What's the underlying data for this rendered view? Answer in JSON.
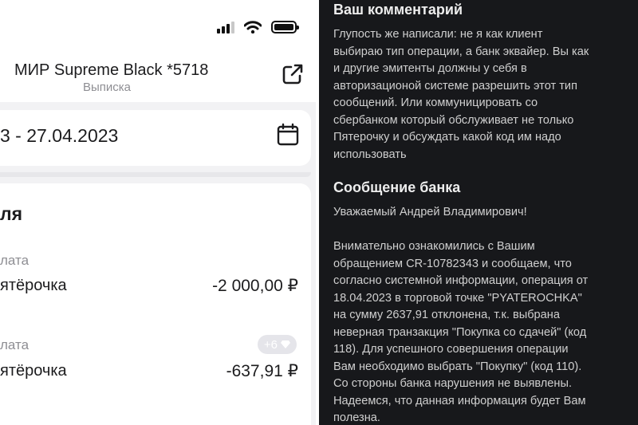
{
  "phone": {
    "card_title": "МИР Supreme Black *5718",
    "card_subtitle": "Выписка",
    "date_range": "3 - 27.04.2023",
    "day_label": "ля",
    "transactions": [
      {
        "type": "лата",
        "merchant": "ятёрочка",
        "amount": "-2 000,00 ₽"
      },
      {
        "type": "лата",
        "merchant": "ятёрочка",
        "amount": "-637,91 ₽",
        "badge": "+6"
      }
    ]
  },
  "comment": {
    "heading": "Ваш комментарий",
    "lines": [
      "Глупость же написали: не я как клиент",
      "выбираю тип операции, а банк эквайер. Вы как",
      "и другие эмитенты должны у себя в",
      "авторизационой системе разрешить этот тип",
      "сообщений. Или коммуницировать со",
      "сбербанком который обслуживает не только",
      "Пятерочку и обсуждать какой код им надо",
      "использовать"
    ]
  },
  "bank": {
    "heading": "Сообщение банка",
    "greeting": "Уважаемый Андрей Владимирович!",
    "lines": [
      "Внимательно ознакомились с Вашим",
      "обращением CR-10782343 и сообщаем, что",
      "согласно системной информации, операция от",
      "18.04.2023 в торговой точке \"PYATEROCHKA\"",
      "на сумму 2637,91 отклонена, т.к. выбрана",
      "неверная транзакция \"Покупка со сдачей\" (код",
      "118). Для успешного совершения операции",
      "Вам необходимо выбрать \"Покупку\" (код 110).",
      "Со стороны банка нарушения не выявлены.",
      "Надеемся, что данная информация будет Вам",
      "полезна."
    ]
  },
  "icons": {
    "share": "share-icon",
    "calendar": "calendar-icon",
    "gem": "gem-icon",
    "wifi": "wifi-icon",
    "signal": "signal-icon",
    "battery": "battery-icon"
  },
  "colors": {
    "panel_dark": "#17181b",
    "text_light": "#cfcfcf",
    "text_gray": "#8e8e93"
  }
}
